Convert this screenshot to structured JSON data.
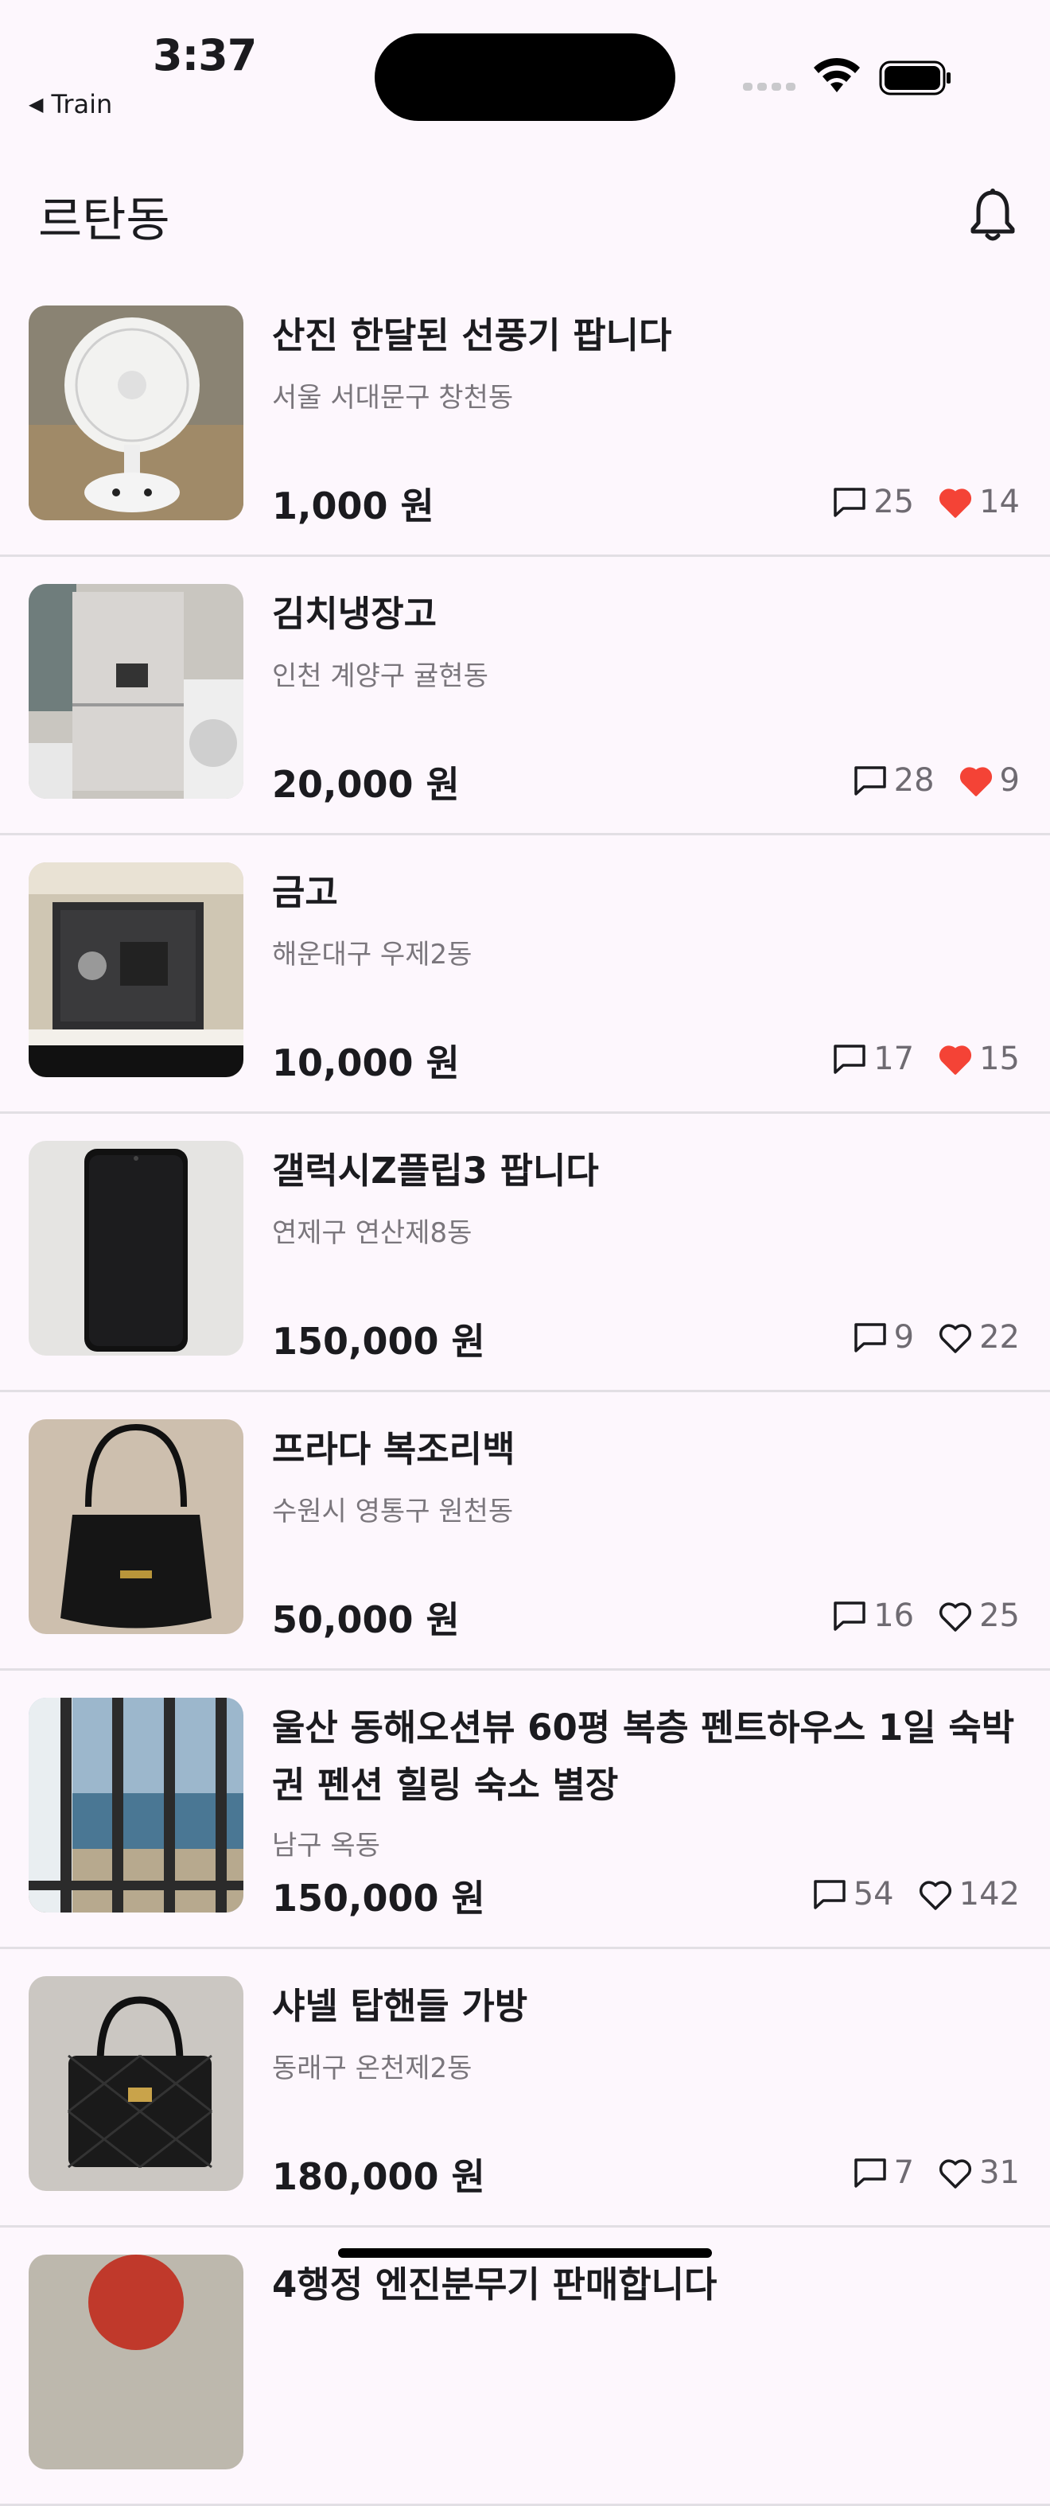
{
  "status": {
    "time": "3:37",
    "back_app": "Train"
  },
  "header": {
    "title": "르탄동",
    "bell_icon": "bell-icon"
  },
  "colors": {
    "background": "#fdf7fd",
    "heart_filled": "#f44336",
    "divider": "#e2dfe4",
    "secondary_text": "#7a767c"
  },
  "items": [
    {
      "title": "산진 한달된 선풍기 팝니다",
      "location": "서울 서대문구 창천동",
      "price": "1,000 원",
      "comments": "25",
      "likes": "14",
      "liked": true,
      "thumb": "fan"
    },
    {
      "title": "김치냉장고",
      "location": "인천 계양구 귤현동",
      "price": "20,000 원",
      "comments": "28",
      "likes": "9",
      "liked": true,
      "thumb": "fridge"
    },
    {
      "title": "금고",
      "location": "해운대구 우제2동",
      "price": "10,000 원",
      "comments": "17",
      "likes": "15",
      "liked": true,
      "thumb": "safe"
    },
    {
      "title": "갤럭시Z플립3 팝니다",
      "location": "연제구 연산제8동",
      "price": "150,000 원",
      "comments": "9",
      "likes": "22",
      "liked": false,
      "thumb": "phone"
    },
    {
      "title": "프라다 복조리백",
      "location": "수원시 영통구 원천동",
      "price": "50,000 원",
      "comments": "16",
      "likes": "25",
      "liked": false,
      "thumb": "bag"
    },
    {
      "title": "울산 동해오션뷰 60평 복층 펜트하우스 1일 숙박권 펜션 힐링 숙소 별장",
      "location": "남구 옥동",
      "price": "150,000 원",
      "comments": "54",
      "likes": "142",
      "liked": false,
      "thumb": "sea"
    },
    {
      "title": "샤넬 탑핸들 가방",
      "location": "동래구 온천제2동",
      "price": "180,000 원",
      "comments": "7",
      "likes": "31",
      "liked": false,
      "thumb": "chanel"
    },
    {
      "title": "4행정 엔진분무기 판매합니다",
      "location": "",
      "price": "",
      "comments": "",
      "likes": "",
      "liked": false,
      "thumb": "engine"
    }
  ]
}
